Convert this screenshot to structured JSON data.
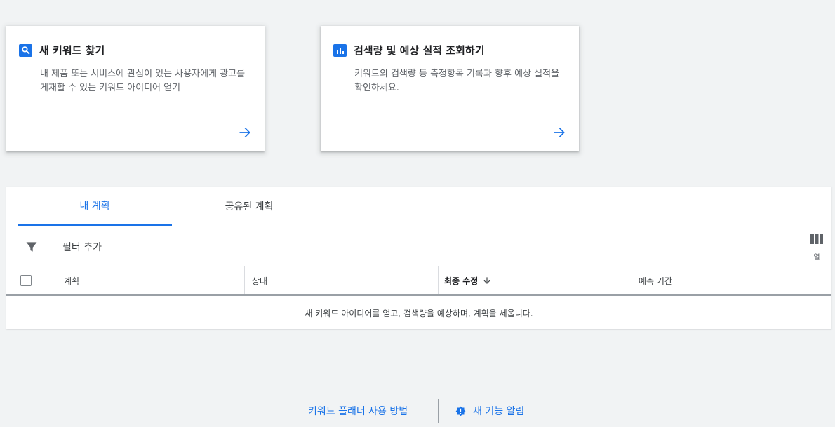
{
  "cards": [
    {
      "title": "새 키워드 찾기",
      "icon": "search-icon",
      "description": "내 제품 또는 서비스에 관심이 있는 사용자에게 광고를 게재할 수 있는 키워드 아이디어 얻기"
    },
    {
      "title": "검색량 및 예상 실적 조회하기",
      "icon": "bar-chart-icon",
      "description": "키워드의 검색량 등 측정항목 기록과 향후 예상 실적을 확인하세요."
    }
  ],
  "tabs": [
    {
      "label": "내 계획",
      "selected": true
    },
    {
      "label": "공유된 계획",
      "selected": false
    }
  ],
  "filter": {
    "label": "필터 추가",
    "columns_label": "열"
  },
  "table": {
    "headers": {
      "plan": "계획",
      "status": "상태",
      "last_modified": "최종 수정",
      "forecast_period": "예측 기간"
    },
    "empty_message": "새 키워드 아이디어를 얻고, 검색량을 예상하며, 계획을 세웁니다."
  },
  "footer": {
    "how_to": "키워드 플래너 사용 방법",
    "whats_new": "새 기능 알림"
  },
  "colors": {
    "accent": "#1a73e8",
    "background": "#f1f3f4"
  }
}
